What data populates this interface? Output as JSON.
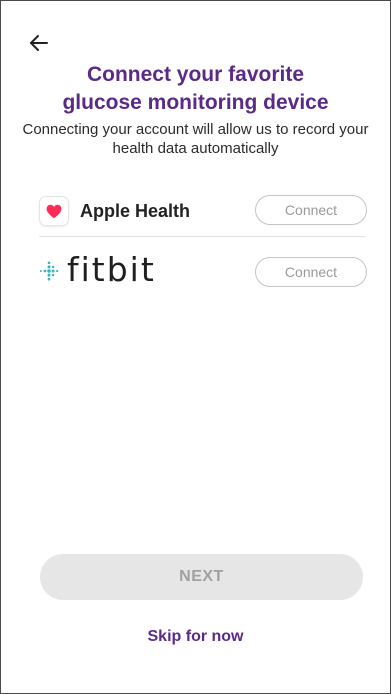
{
  "header": {
    "back_icon": "arrow-left-icon",
    "title_line1": "Connect your favorite",
    "title_line2": "glucose monitoring device",
    "subtitle": "Connecting your account will allow us to record your health data automatically"
  },
  "providers": [
    {
      "name": "Apple Health",
      "icon": "heart-icon",
      "connect_label": "Connect"
    },
    {
      "name": "fitbit",
      "icon": "fitbit-dots-icon",
      "connect_label": "Connect"
    }
  ],
  "footer": {
    "next_label": "NEXT",
    "skip_label": "Skip for now"
  },
  "colors": {
    "brand_purple": "#5b2a86",
    "heart_red": "#ff2d55",
    "fitbit_teal": "#34b3b8",
    "disabled_bg": "#e6e6e6",
    "disabled_text": "#a0a0a0"
  }
}
